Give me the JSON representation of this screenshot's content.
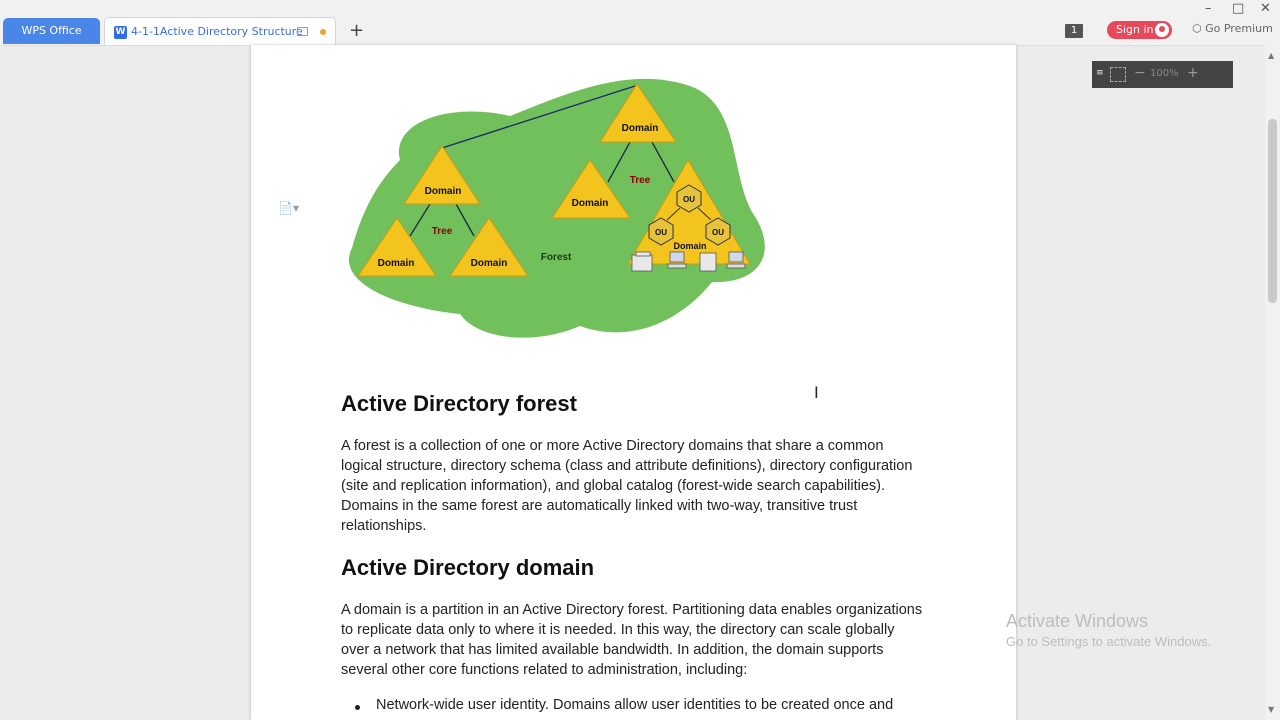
{
  "titlebar": {
    "app_tab": "WPS Office",
    "doc_tab_icon": "W",
    "doc_tab_title": "4-1-1Active Directory Structure",
    "new_tab": "+",
    "page_count_badge": "1",
    "sign_in": "Sign in",
    "premium": "Go Premium",
    "window_controls": [
      "–",
      "□",
      "✕"
    ]
  },
  "diagram": {
    "forest_label": "Forest",
    "tree_label": "Tree",
    "domain_label": "Domain",
    "ou_label": "OU",
    "colors": {
      "forest": "#72c05c",
      "triangle": "#f3c41e",
      "tree_text": "#8b0000",
      "hexagon": "#e6c33a"
    }
  },
  "document": {
    "heading1": "Active Directory forest",
    "para1": "A forest is a collection of one or more Active Directory domains that share a common logical structure, directory schema (class and attribute definitions), directory configuration (site and replication information), and global catalog (forest-wide search capabilities). Domains in the same forest are automatically linked with two-way, transitive trust relationships.",
    "heading2": "Active Directory domain",
    "para2": "A domain is a partition in an Active Directory forest. Partitioning data enables organizations to replicate data only to where it is needed. In this way, the directory can scale globally over a network that has limited available bandwidth. In addition, the domain supports several other core functions related to administration, including:",
    "bullet1": "Network-wide user identity. Domains allow user identities to be created once and"
  },
  "zoom": {
    "value": "100%",
    "minus": "−",
    "plus": "+"
  },
  "watermark": {
    "line1": "Activate Windows",
    "line2": "Go to Settings to activate Windows."
  }
}
